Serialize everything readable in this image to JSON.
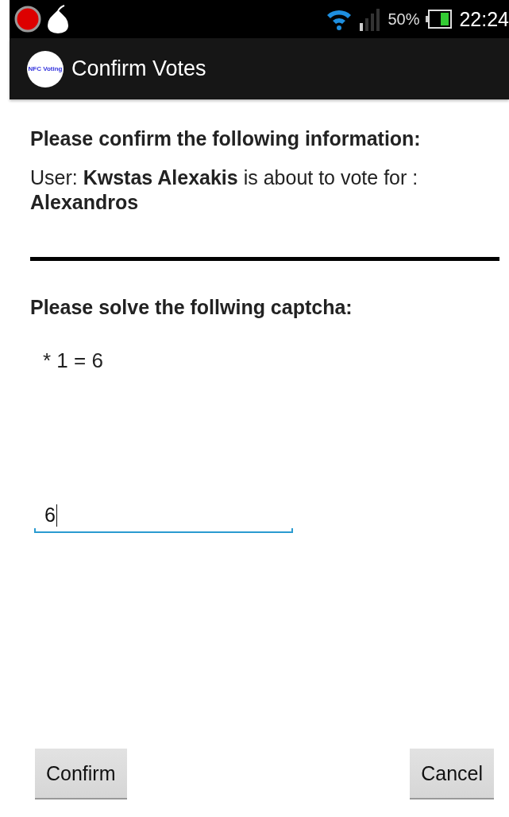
{
  "status_bar": {
    "battery": "50%",
    "time": "22:24"
  },
  "action_bar": {
    "logo_text": "NFC Voting",
    "title": "Confirm Votes"
  },
  "info": {
    "heading": "Please confirm the following information:",
    "message": "User: **Kwstas Alexakis** is about to vote for : **Alexandros**"
  },
  "captcha": {
    "heading": "Please solve the follwing captcha:",
    "question": "* 1 = 6"
  },
  "answer_field": {
    "value": "6"
  },
  "buttons": [
    {
      "label": "Confirm"
    },
    {
      "label": "Cancel"
    }
  ]
}
